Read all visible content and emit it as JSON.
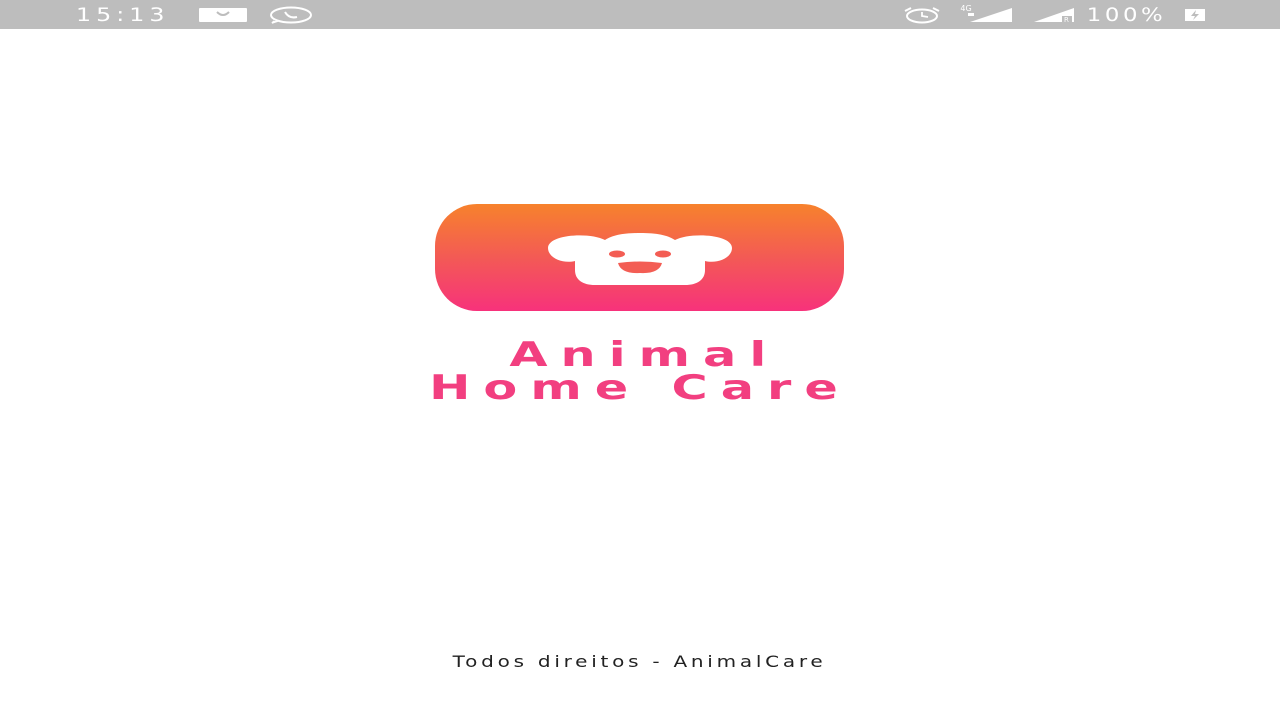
{
  "status_bar": {
    "time": "15:13",
    "left_icons": [
      "email-icon",
      "whatsapp-icon"
    ],
    "right_icons": [
      "alarm-icon",
      "signal-4g-icon",
      "signal-icon",
      "battery-charging-icon"
    ],
    "network_label": "4G",
    "signal_sub_label": "R",
    "battery_percent": "100%"
  },
  "splash": {
    "logo_icon": "dog-face-icon",
    "app_name_line1": "Animal",
    "app_name_line2": "Home Care",
    "footer_text": "Todos direitos - AnimalCare"
  },
  "colors": {
    "status_bar": "#bdbdbd",
    "gradient_top": "#f7822c",
    "gradient_bottom": "#f7327b",
    "brand_pink": "#f23f80",
    "footer_text": "#222222"
  }
}
